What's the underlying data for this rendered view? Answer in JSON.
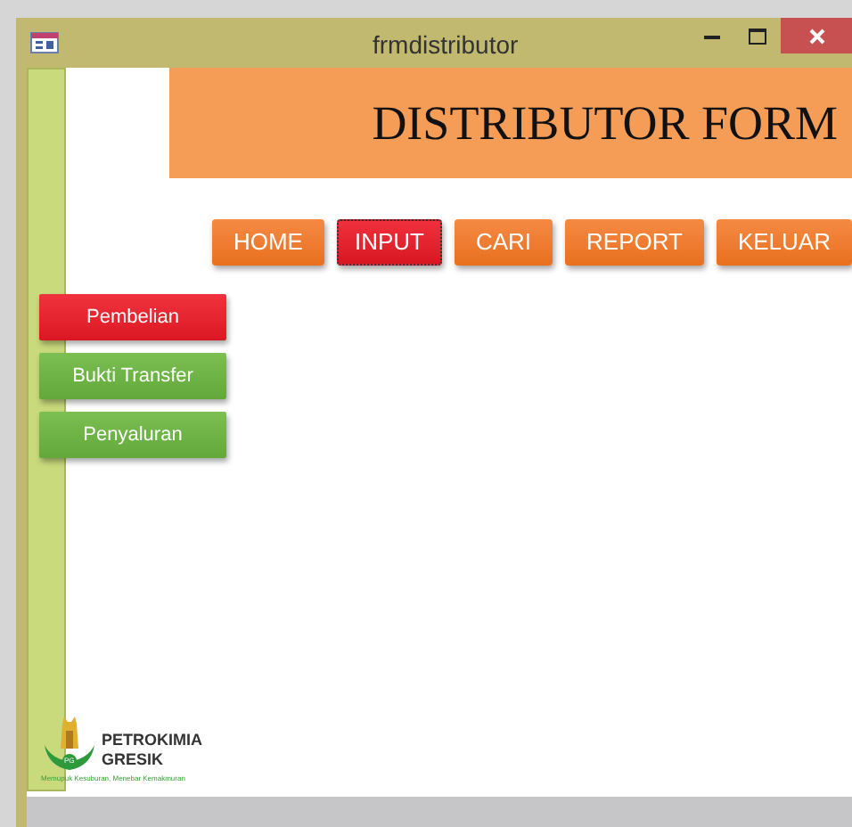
{
  "window": {
    "title": "frmdistributor"
  },
  "header": {
    "title": "DISTRIBUTOR FORM"
  },
  "nav_buttons": [
    {
      "label": "HOME",
      "selected": false
    },
    {
      "label": "INPUT",
      "selected": true
    },
    {
      "label": "CARI",
      "selected": false
    },
    {
      "label": "REPORT",
      "selected": false
    },
    {
      "label": "KELUAR",
      "selected": false
    }
  ],
  "side_buttons": [
    {
      "label": "Pembelian",
      "selected": true
    },
    {
      "label": "Bukti Transfer",
      "selected": false
    },
    {
      "label": "Penyaluran",
      "selected": false
    }
  ],
  "logo": {
    "badge": "PG",
    "name_line_1": "PETROKIMIA",
    "name_line_2": "GRESIK",
    "tagline": "Memupuk Kesuburan, Menebar Kemakmuran"
  }
}
